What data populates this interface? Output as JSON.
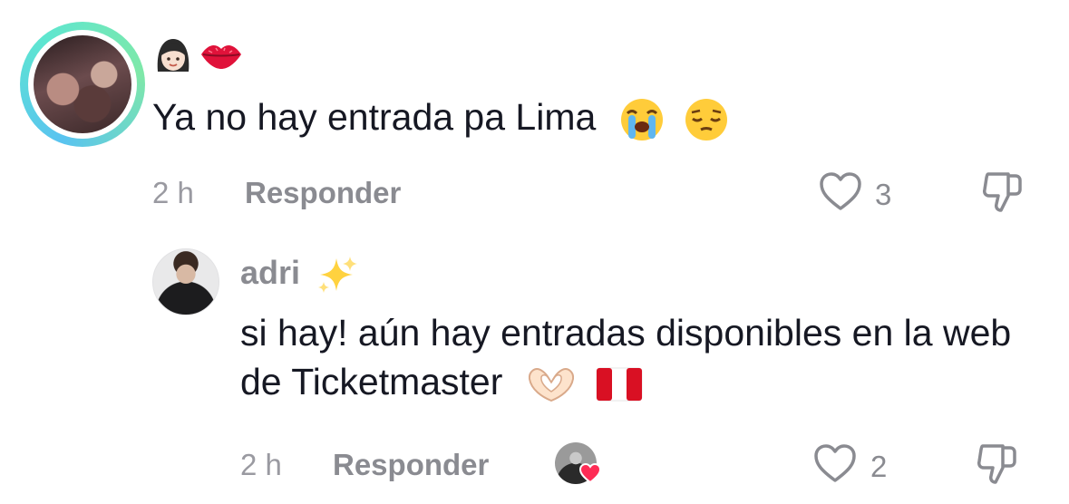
{
  "comment": {
    "username_emojis": [
      "woman-emoji",
      "kiss-mark-emoji"
    ],
    "text": "Ya no hay entrada pa Lima",
    "text_emojis": [
      "loudly-crying-face-emoji",
      "pensive-face-emoji"
    ],
    "time": "2 h",
    "reply_label": "Responder",
    "like_count": "3"
  },
  "reply": {
    "username": "adri",
    "username_emoji": "sparkles-emoji",
    "text": "si hay! aún hay entradas disponibles en la web de Ticketmaster",
    "text_emojis": [
      "heart-hands-emoji",
      "peru-flag-emoji"
    ],
    "time": "2 h",
    "reply_label": "Responder",
    "like_count": "2",
    "creator_liked": true
  },
  "colors": {
    "text": "#161823",
    "secondary": "#8a8b91",
    "heart": "#fe2c55",
    "avatar_ring": "#5ee6d0"
  }
}
